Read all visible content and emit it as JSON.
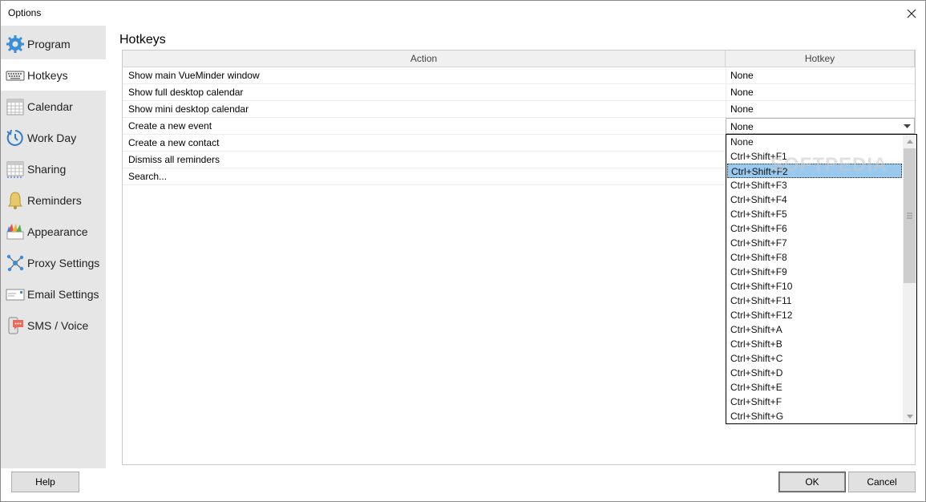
{
  "window": {
    "title": "Options"
  },
  "sidebar": {
    "items": [
      {
        "label": "Program",
        "icon": "gear-icon"
      },
      {
        "label": "Hotkeys",
        "icon": "keyboard-icon",
        "active": true
      },
      {
        "label": "Calendar",
        "icon": "calendar-icon"
      },
      {
        "label": "Work Day",
        "icon": "clock-icon"
      },
      {
        "label": "Sharing",
        "icon": "shared-calendar-icon"
      },
      {
        "label": "Reminders",
        "icon": "bell-icon"
      },
      {
        "label": "Appearance",
        "icon": "palette-icon"
      },
      {
        "label": "Proxy Settings",
        "icon": "network-icon"
      },
      {
        "label": "Email Settings",
        "icon": "envelope-icon"
      },
      {
        "label": "SMS / Voice",
        "icon": "phone-chat-icon"
      }
    ]
  },
  "main": {
    "heading": "Hotkeys",
    "columns": {
      "action": "Action",
      "hotkey": "Hotkey"
    },
    "rows": [
      {
        "action": "Show main VueMinder window",
        "hotkey": "None"
      },
      {
        "action": "Show full desktop calendar",
        "hotkey": "None"
      },
      {
        "action": "Show mini desktop calendar",
        "hotkey": "None"
      },
      {
        "action": "Create a new event",
        "hotkey": "None"
      },
      {
        "action": "Create a new contact",
        "hotkey": ""
      },
      {
        "action": "Dismiss all reminders",
        "hotkey": ""
      },
      {
        "action": "Search...",
        "hotkey": ""
      }
    ]
  },
  "dropdown": {
    "selected": "Ctrl+Shift+F2",
    "options": [
      "None",
      "Ctrl+Shift+F1",
      "Ctrl+Shift+F2",
      "Ctrl+Shift+F3",
      "Ctrl+Shift+F4",
      "Ctrl+Shift+F5",
      "Ctrl+Shift+F6",
      "Ctrl+Shift+F7",
      "Ctrl+Shift+F8",
      "Ctrl+Shift+F9",
      "Ctrl+Shift+F10",
      "Ctrl+Shift+F11",
      "Ctrl+Shift+F12",
      "Ctrl+Shift+A",
      "Ctrl+Shift+B",
      "Ctrl+Shift+C",
      "Ctrl+Shift+D",
      "Ctrl+Shift+E",
      "Ctrl+Shift+F",
      "Ctrl+Shift+G"
    ]
  },
  "watermark": "SOFTPEDIA",
  "footer": {
    "help_label": "Help",
    "ok_label": "OK",
    "cancel_label": "Cancel"
  },
  "colors": {
    "selection": "#99c9ef",
    "sidebar_bg": "#e6e6e6"
  }
}
